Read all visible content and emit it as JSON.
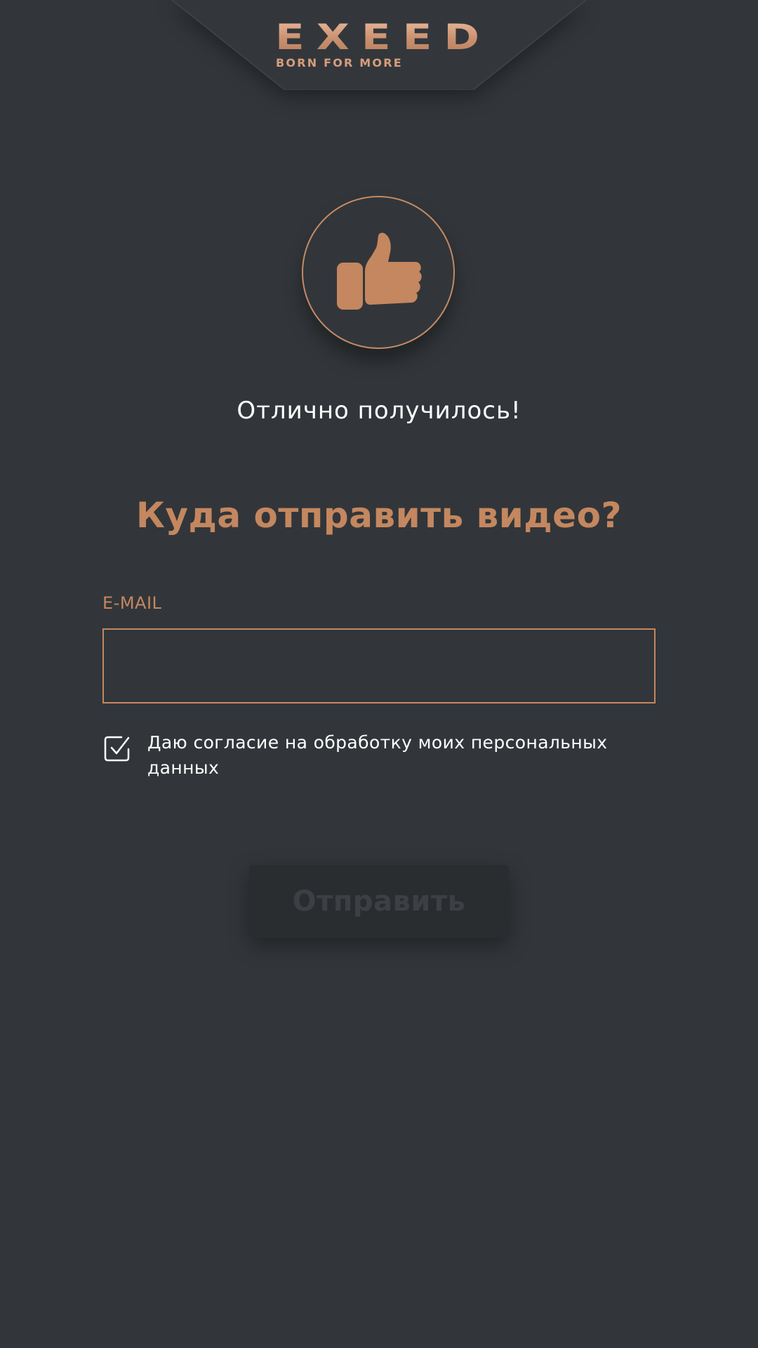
{
  "header": {
    "logo_text": "EXEED",
    "tagline": "BORN FOR MORE"
  },
  "success": {
    "icon": "thumbs-up-icon",
    "message": "Отлично получилось!"
  },
  "form": {
    "title": "Куда отправить видео?",
    "email_label": "E-MAIL",
    "email_value": "",
    "email_placeholder": "",
    "consent_checked": true,
    "consent_text": "Даю согласие на обработку моих персональных данных",
    "submit_label": "Отправить"
  },
  "colors": {
    "background": "#32363a",
    "accent": "#c4875f",
    "text": "#ffffff",
    "button_bg": "#2a2d30",
    "button_text": "#3c4045"
  }
}
